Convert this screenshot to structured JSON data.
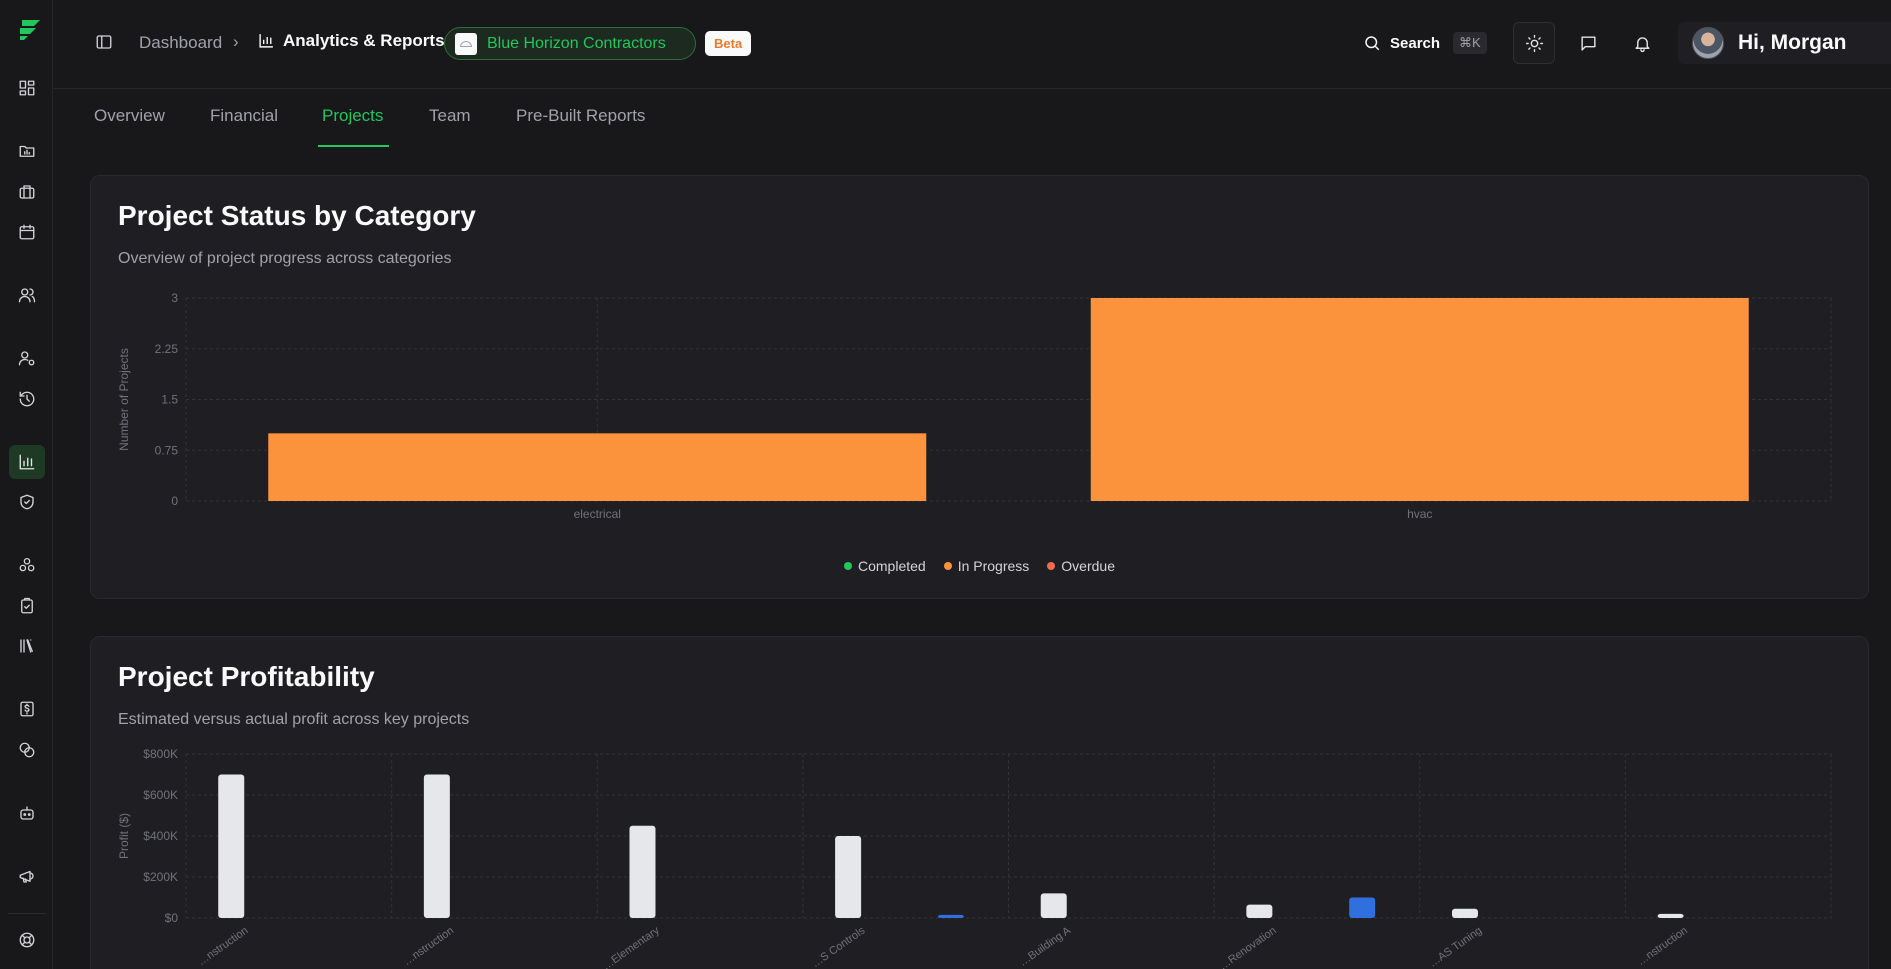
{
  "header": {
    "breadcrumb_root": "Dashboard",
    "breadcrumb_sep": "›",
    "breadcrumb_current": "Analytics & Reports",
    "company_name": "Blue Horizon Contractors",
    "beta_label": "Beta",
    "search_label": "Search",
    "search_shortcut": "⌘K",
    "greeting": "Hi, Morgan"
  },
  "tabs": [
    {
      "label": "Overview"
    },
    {
      "label": "Financial"
    },
    {
      "label": "Projects",
      "active": true
    },
    {
      "label": "Team"
    },
    {
      "label": "Pre-Built Reports"
    }
  ],
  "colors": {
    "accent": "#22c55e",
    "in_progress": "#fb923c",
    "completed": "#22c55e",
    "overdue": "#f26b4f",
    "estimated": "#e5e7eb",
    "actual": "#2f6fde"
  },
  "status_card": {
    "title": "Project Status by Category",
    "subtitle": "Overview of project progress across categories"
  },
  "profit_card": {
    "title": "Project Profitability",
    "subtitle": "Estimated versus actual profit across key projects"
  },
  "chart_data": [
    {
      "type": "bar",
      "title": "Project Status by Category",
      "ylabel": "Number of Projects",
      "categories": [
        "electrical",
        "hvac"
      ],
      "yticks": [
        "0",
        "0.75",
        "1.5",
        "2.25",
        "3"
      ],
      "ylim": [
        0,
        3
      ],
      "stacked": true,
      "grid": true,
      "legend_position": "bottom",
      "series": [
        {
          "name": "Completed",
          "values": [
            0,
            0
          ]
        },
        {
          "name": "In Progress",
          "values": [
            1,
            3
          ]
        },
        {
          "name": "Overdue",
          "values": [
            0,
            0
          ]
        }
      ]
    },
    {
      "type": "bar",
      "title": "Project Profitability",
      "ylabel": "Profit ($)",
      "categories": [
        "…nstruction",
        "…nstruction",
        "…Elementary",
        "…S Controls",
        "…Building A",
        "…Renovation",
        "…AS Tuning",
        "…nstruction"
      ],
      "yticks": [
        "$0",
        "$200K",
        "$400K",
        "$600K",
        "$800K"
      ],
      "ylim": [
        0,
        800000
      ],
      "grid": true,
      "series": [
        {
          "values": [
            700000,
            700000,
            450000,
            400000,
            120000,
            65000,
            45000,
            20000
          ]
        },
        {
          "values": [
            0,
            0,
            0,
            15000,
            0,
            100000,
            0,
            0
          ]
        }
      ]
    }
  ]
}
